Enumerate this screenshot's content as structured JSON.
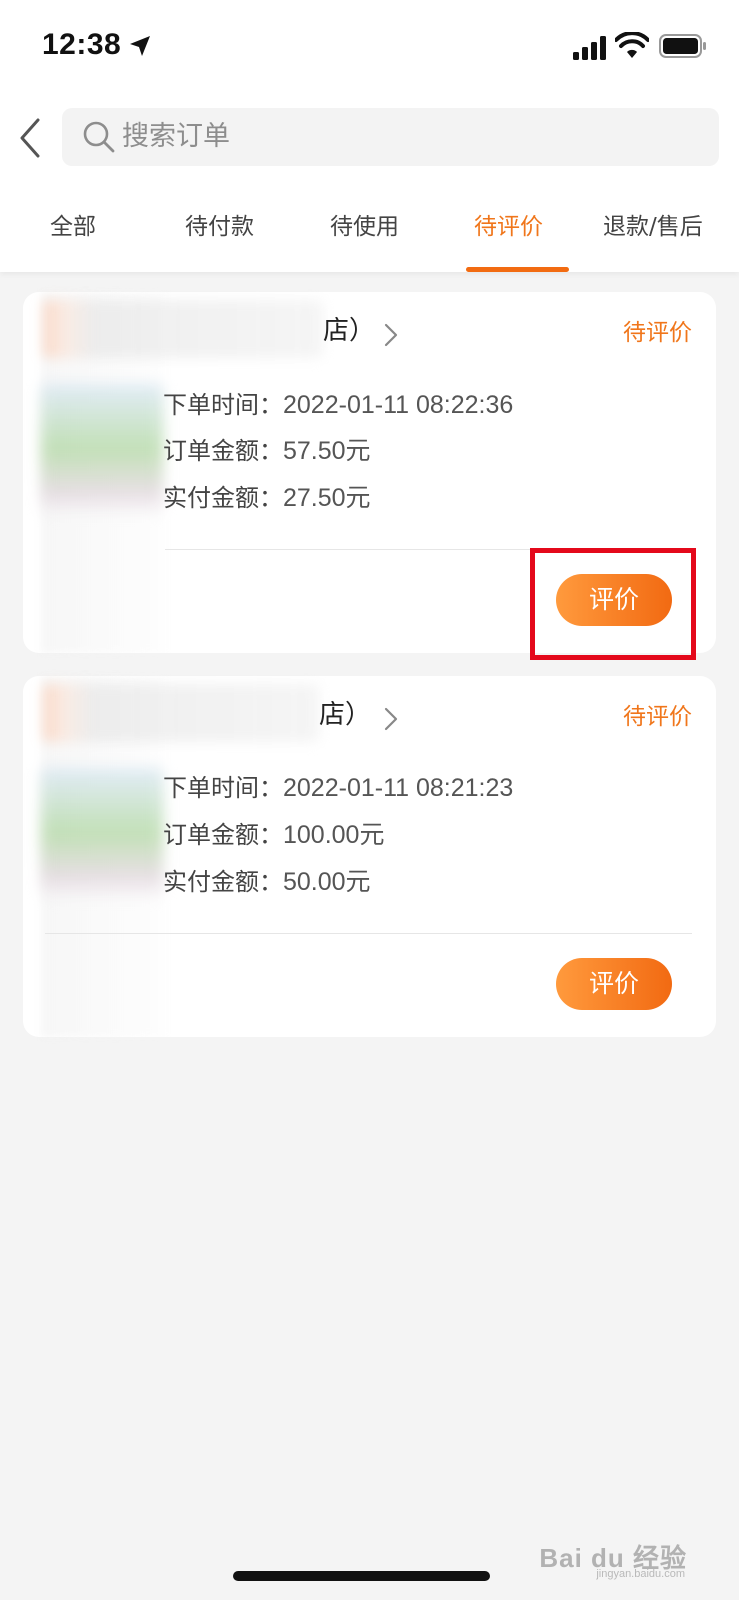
{
  "status_bar": {
    "time": "12:38",
    "icons": [
      "location-arrow-icon",
      "cellular-signal-icon",
      "wifi-icon",
      "battery-icon"
    ]
  },
  "header": {
    "back_icon": "chevron-left-icon",
    "search": {
      "icon": "search-icon",
      "placeholder": "搜索订单"
    }
  },
  "tabs": [
    {
      "label": "全部",
      "active": false
    },
    {
      "label": "待付款",
      "active": false
    },
    {
      "label": "待使用",
      "active": false
    },
    {
      "label": "待评价",
      "active": true
    },
    {
      "label": "退款/售后",
      "active": false
    }
  ],
  "orders": [
    {
      "shop_name_visible": "店）",
      "status": "待评价",
      "order_time_label": "下单时间：",
      "order_time": "2022-01-11 08:22:36",
      "order_amount_label": "订单金额：",
      "order_amount": "57.50元",
      "paid_amount_label": "实付金额：",
      "paid_amount": "27.50元",
      "action_label": "评价"
    },
    {
      "shop_name_visible": "店）",
      "status": "待评价",
      "order_time_label": "下单时间：",
      "order_time": "2022-01-11 08:21:23",
      "order_amount_label": "订单金额：",
      "order_amount": "100.00元",
      "paid_amount_label": "实付金额：",
      "paid_amount": "50.00元",
      "action_label": "评价"
    }
  ],
  "watermark": {
    "text": "Bai du 经验",
    "sub": "jingyan.baidu.com"
  },
  "colors": {
    "accent": "#f0761b",
    "button_gradient_start": "#ff9a3d",
    "button_gradient_end": "#f26a12",
    "highlight": "#e4091b",
    "background": "#f4f4f4"
  }
}
